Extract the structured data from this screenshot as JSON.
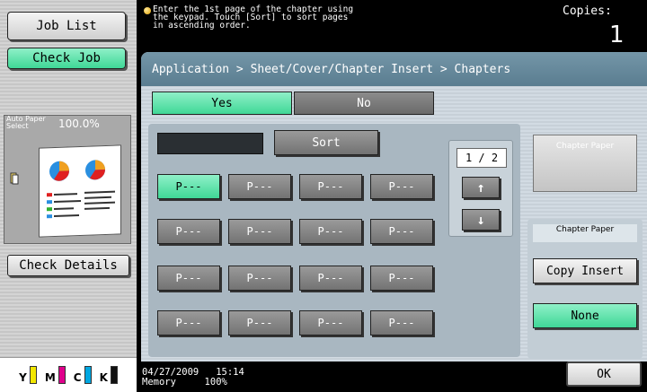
{
  "left_panel": {
    "job_list_label": "Job List",
    "check_job_label": "Check Job",
    "auto_paper_select": "Auto Paper Select",
    "zoom": "100.0%",
    "check_details_label": "Check Details",
    "toner": [
      {
        "letter": "Y",
        "color": "#f2e600"
      },
      {
        "letter": "M",
        "color": "#e0008c"
      },
      {
        "letter": "C",
        "color": "#00a7e1"
      },
      {
        "letter": "K",
        "color": "#111111"
      }
    ]
  },
  "message": {
    "text": "Enter the 1st page of  the chapter using\nthe keypad. Touch [Sort] to sort pages\nin ascending order.",
    "copies_label": "Copies:",
    "copies_value": "1"
  },
  "breadcrumb": "Application > Sheet/Cover/Chapter Insert > Chapters",
  "yes_label": "Yes",
  "no_label": "No",
  "sort_label": "Sort",
  "page_buttons": [
    "P---",
    "P---",
    "P---",
    "P---",
    "P---",
    "P---",
    "P---",
    "P---",
    "P---",
    "P---",
    "P---",
    "P---",
    "P---",
    "P---",
    "P---",
    "P---"
  ],
  "pager": {
    "page": "1 / 2",
    "up_icon": "↑",
    "down_icon": "↓"
  },
  "chapter_paper_button": "Chapter Paper",
  "chapter_paper_label": "Chapter Paper",
  "copy_insert_label": "Copy Insert",
  "none_label": "None",
  "status": {
    "date": "04/27/2009",
    "time": "15:14",
    "memory_label": "Memory",
    "memory_value": "100%"
  },
  "ok_label": "OK"
}
